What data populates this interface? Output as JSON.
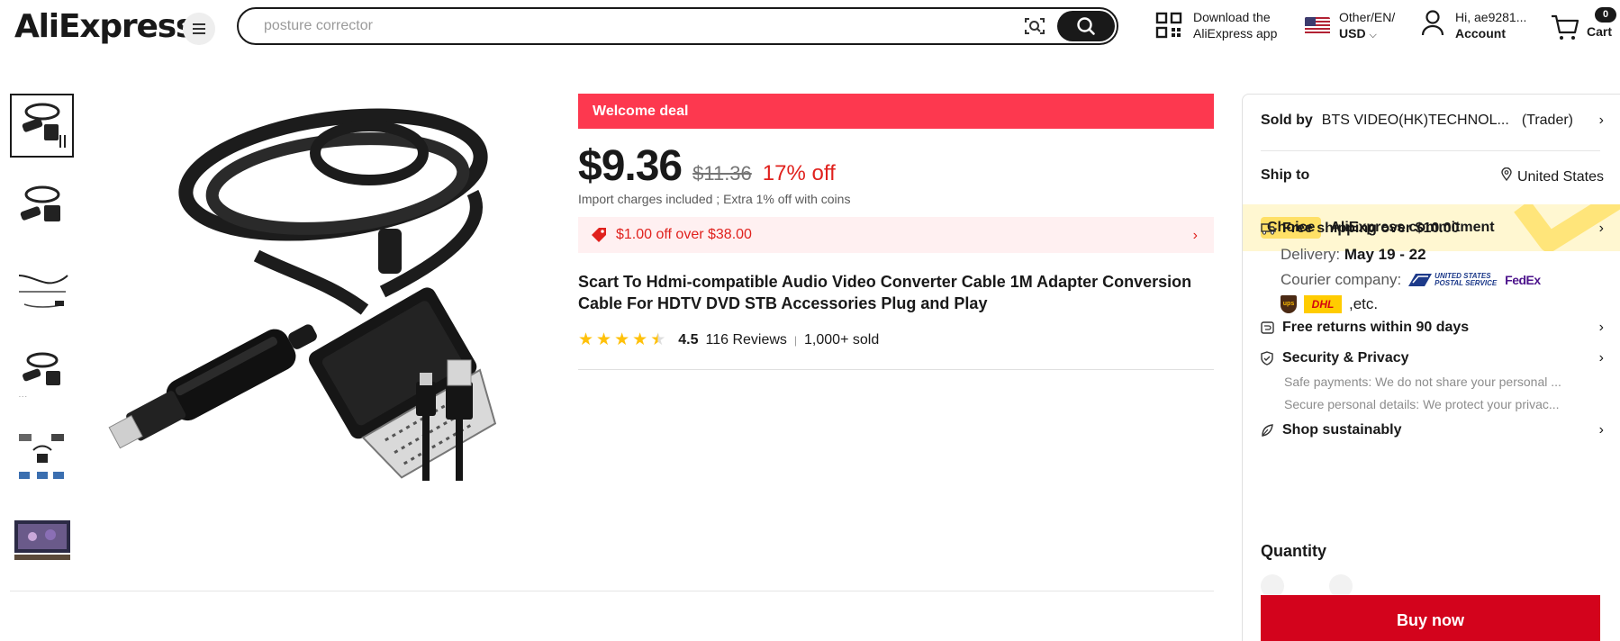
{
  "header": {
    "logo": "AliExpress",
    "search_placeholder": "posture corrector",
    "app_download": [
      "Download the",
      "AliExpress app"
    ],
    "region": [
      "Other/EN/",
      "USD"
    ],
    "account": [
      "Hi, ae9281...",
      "Account"
    ],
    "cart_count": "0",
    "cart_label": "Cart"
  },
  "thumbnails": [
    "thumb-1",
    "thumb-2",
    "thumb-3",
    "thumb-4",
    "thumb-5",
    "thumb-6"
  ],
  "product": {
    "deal_banner": "Welcome deal",
    "price": "$9.36",
    "old_price": "$11.36",
    "discount": "17% off",
    "tax_note": "Import charges included ; Extra 1% off with coins",
    "coupon": "$1.00 off over $38.00",
    "title": "Scart To Hdmi-compatible Audio Video Converter Cable 1M Adapter Conversion Cable For HDTV DVD STB Accessories Plug and Play",
    "rating": "4.5",
    "rating_value": 4.5,
    "reviews": "116 Reviews",
    "sold": "1,000+ sold"
  },
  "panel": {
    "sold_by_label": "Sold by",
    "seller": "BTS VIDEO(HK)TECHNOL...",
    "seller_type": "(Trader)",
    "ship_to_label": "Ship to",
    "ship_to_value": "United States",
    "choice_chip": "Choice",
    "choice_text": "AliExpress commitment",
    "free_shipping": "Free shipping over $10.00",
    "delivery_label": "Delivery:",
    "delivery_value": "May 19 - 22",
    "courier_label": "Courier company:",
    "courier_usps": "UNITED STATES POSTAL SERVICE",
    "courier_fedex": "FedEx",
    "courier_ups": "ups",
    "courier_dhl": "DHL",
    "courier_etc": ",etc.",
    "free_returns": "Free returns within 90 days",
    "security": "Security & Privacy",
    "safe_payments": "Safe payments: We do not share your personal ...",
    "secure_details": "Secure personal details: We protect your privac...",
    "sustain": "Shop sustainably",
    "quantity_label": "Quantity",
    "buy_now": "Buy now"
  },
  "colors": {
    "deal_red": "#fd384f",
    "buy_red": "#d3031c",
    "price_red": "#e0211d",
    "choice_yellow": "#ffe066",
    "star": "#ffc10a"
  }
}
